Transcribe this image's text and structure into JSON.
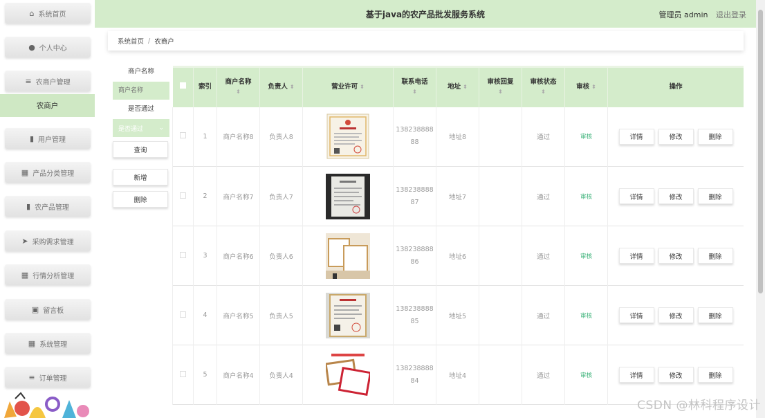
{
  "header": {
    "title": "基于java的农产品批发服务系统",
    "user": "管理员 admin",
    "logout": "退出登录"
  },
  "sidebar": {
    "items": [
      {
        "label": "系统首页",
        "icon": "home-icon",
        "glyph": "⌂"
      },
      {
        "label": "个人中心",
        "icon": "user-icon",
        "glyph": "●"
      },
      {
        "label": "农商户管理",
        "icon": "menu-icon",
        "glyph": "≡"
      },
      {
        "label": "用户管理",
        "icon": "chart-icon",
        "glyph": "▮"
      },
      {
        "label": "产品分类管理",
        "icon": "grid-icon",
        "glyph": "▦"
      },
      {
        "label": "农产品管理",
        "icon": "bar-chart-icon",
        "glyph": "▮"
      },
      {
        "label": "采购需求管理",
        "icon": "send-icon",
        "glyph": "➤"
      },
      {
        "label": "行情分析管理",
        "icon": "table-icon",
        "glyph": "▦"
      },
      {
        "label": "留言板",
        "icon": "message-icon",
        "glyph": "▣"
      },
      {
        "label": "系统管理",
        "icon": "grid-icon",
        "glyph": "▦"
      },
      {
        "label": "订单管理",
        "icon": "list-icon",
        "glyph": "≡"
      }
    ],
    "active_sub": "农商户"
  },
  "breadcrumb": {
    "home": "系统首页",
    "sep": "/",
    "current": "农商户"
  },
  "search": {
    "name_label": "商户名称",
    "name_placeholder": "商户名称",
    "pass_label": "是否通过",
    "pass_placeholder": "是否通过",
    "query": "查询",
    "add": "新增",
    "delete": "删除"
  },
  "table": {
    "columns": [
      "索引",
      "商户名称",
      "负责人",
      "营业许可",
      "联系电话",
      "地址",
      "审核回复",
      "审核状态",
      "审核",
      "操作"
    ],
    "rows": [
      {
        "index": "1",
        "name": "商户名称8",
        "owner": "负责人8",
        "phone1": "138238888",
        "phone2": "88",
        "address": "地址8",
        "reply": "",
        "status": "通过",
        "audit": "审核"
      },
      {
        "index": "2",
        "name": "商户名称7",
        "owner": "负责人7",
        "phone1": "138238888",
        "phone2": "87",
        "address": "地址7",
        "reply": "",
        "status": "通过",
        "audit": "审核"
      },
      {
        "index": "3",
        "name": "商户名称6",
        "owner": "负责人6",
        "phone1": "138238888",
        "phone2": "86",
        "address": "地址6",
        "reply": "",
        "status": "通过",
        "audit": "审核"
      },
      {
        "index": "4",
        "name": "商户名称5",
        "owner": "负责人5",
        "phone1": "138238888",
        "phone2": "85",
        "address": "地址5",
        "reply": "",
        "status": "通过",
        "audit": "审核"
      },
      {
        "index": "5",
        "name": "商户名称4",
        "owner": "负责人4",
        "phone1": "138238888",
        "phone2": "84",
        "address": "地址4",
        "reply": "",
        "status": "通过",
        "audit": "审核"
      }
    ],
    "ops": {
      "detail": "详情",
      "edit": "修改",
      "delete": "删除"
    }
  },
  "watermark": "CSDN @林科程序设计",
  "colors": {
    "accent": "#d4eccb",
    "active_sub": "#cfe8c4",
    "audit_link": "#3eb37a"
  }
}
